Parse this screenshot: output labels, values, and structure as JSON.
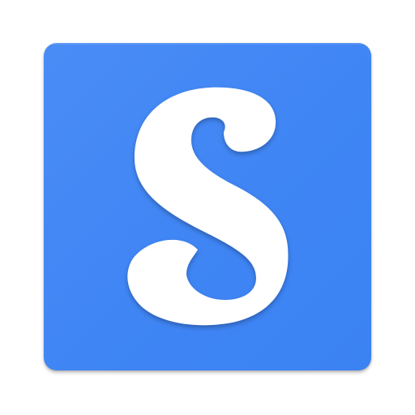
{
  "app_icon": {
    "glyph": "S",
    "icon_name": "letter-s-icon",
    "background_color": "#4287f5",
    "glyph_color": "#ffffff"
  }
}
